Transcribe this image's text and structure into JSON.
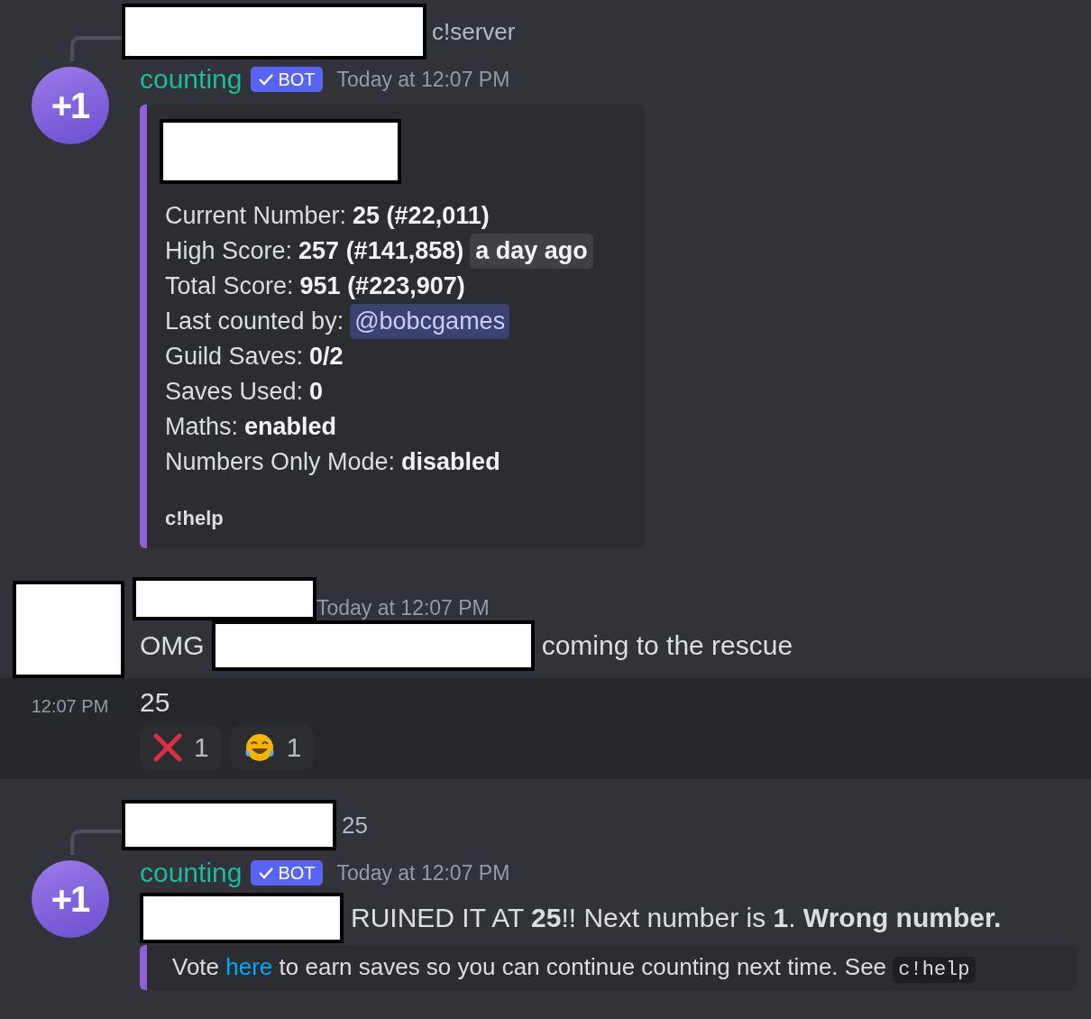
{
  "messages": [
    {
      "kind": "bot",
      "avatar": "+1",
      "reply": {
        "author": {
          "kind": "redacted"
        },
        "text": "c!server"
      },
      "author": "counting",
      "badge": "BOT",
      "time": "Today at 12:07 PM",
      "embed": {
        "title": {
          "kind": "redacted"
        },
        "fields": [
          {
            "label": "Current Number:",
            "value": "25 (#22,011)"
          },
          {
            "label": "High Score:",
            "value": "257 (#141,858)",
            "tag": "a day ago"
          },
          {
            "label": "Total Score:",
            "value": "951 (#223,907)"
          },
          {
            "label": "Last counted by:",
            "mention": "@bobcgames"
          },
          {
            "label": "Guild Saves:",
            "value": "0/2"
          },
          {
            "label": "Saves Used:",
            "value": "0"
          },
          {
            "label": "Maths:",
            "value": "enabled"
          },
          {
            "label": "Numbers Only Mode:",
            "value": "disabled"
          }
        ],
        "footer": "c!help"
      }
    },
    {
      "kind": "user",
      "avatar": {
        "kind": "redacted"
      },
      "author": {
        "kind": "redacted"
      },
      "time": "Today at 12:07 PM",
      "content": [
        {
          "kind": "text",
          "text": "OMG"
        },
        {
          "kind": "redacted"
        },
        {
          "kind": "text",
          "text": "coming to the rescue"
        }
      ]
    },
    {
      "kind": "followup",
      "hovered": true,
      "time": "12:07 PM",
      "text": "25",
      "reactions": [
        {
          "kind": "cross",
          "count": "1"
        },
        {
          "kind": "laughing",
          "count": "1"
        }
      ]
    },
    {
      "kind": "bot",
      "avatar": "+1",
      "reply": {
        "author": {
          "kind": "redacted"
        },
        "text": "25"
      },
      "author": "counting",
      "badge": "BOT",
      "time": "Today at 12:07 PM",
      "content": [
        {
          "kind": "redacted"
        },
        {
          "kind": "text",
          "text": "RUINED IT AT **25**!! Next number is **1**. **Wrong number.**"
        }
      ],
      "embed": {
        "description": [
          {
            "kind": "text",
            "text": "Vote "
          },
          {
            "kind": "link",
            "text": "here"
          },
          {
            "kind": "text",
            "text": " to earn saves so you can continue counting next time. See "
          },
          {
            "kind": "code",
            "text": "c!help"
          }
        ]
      }
    }
  ]
}
